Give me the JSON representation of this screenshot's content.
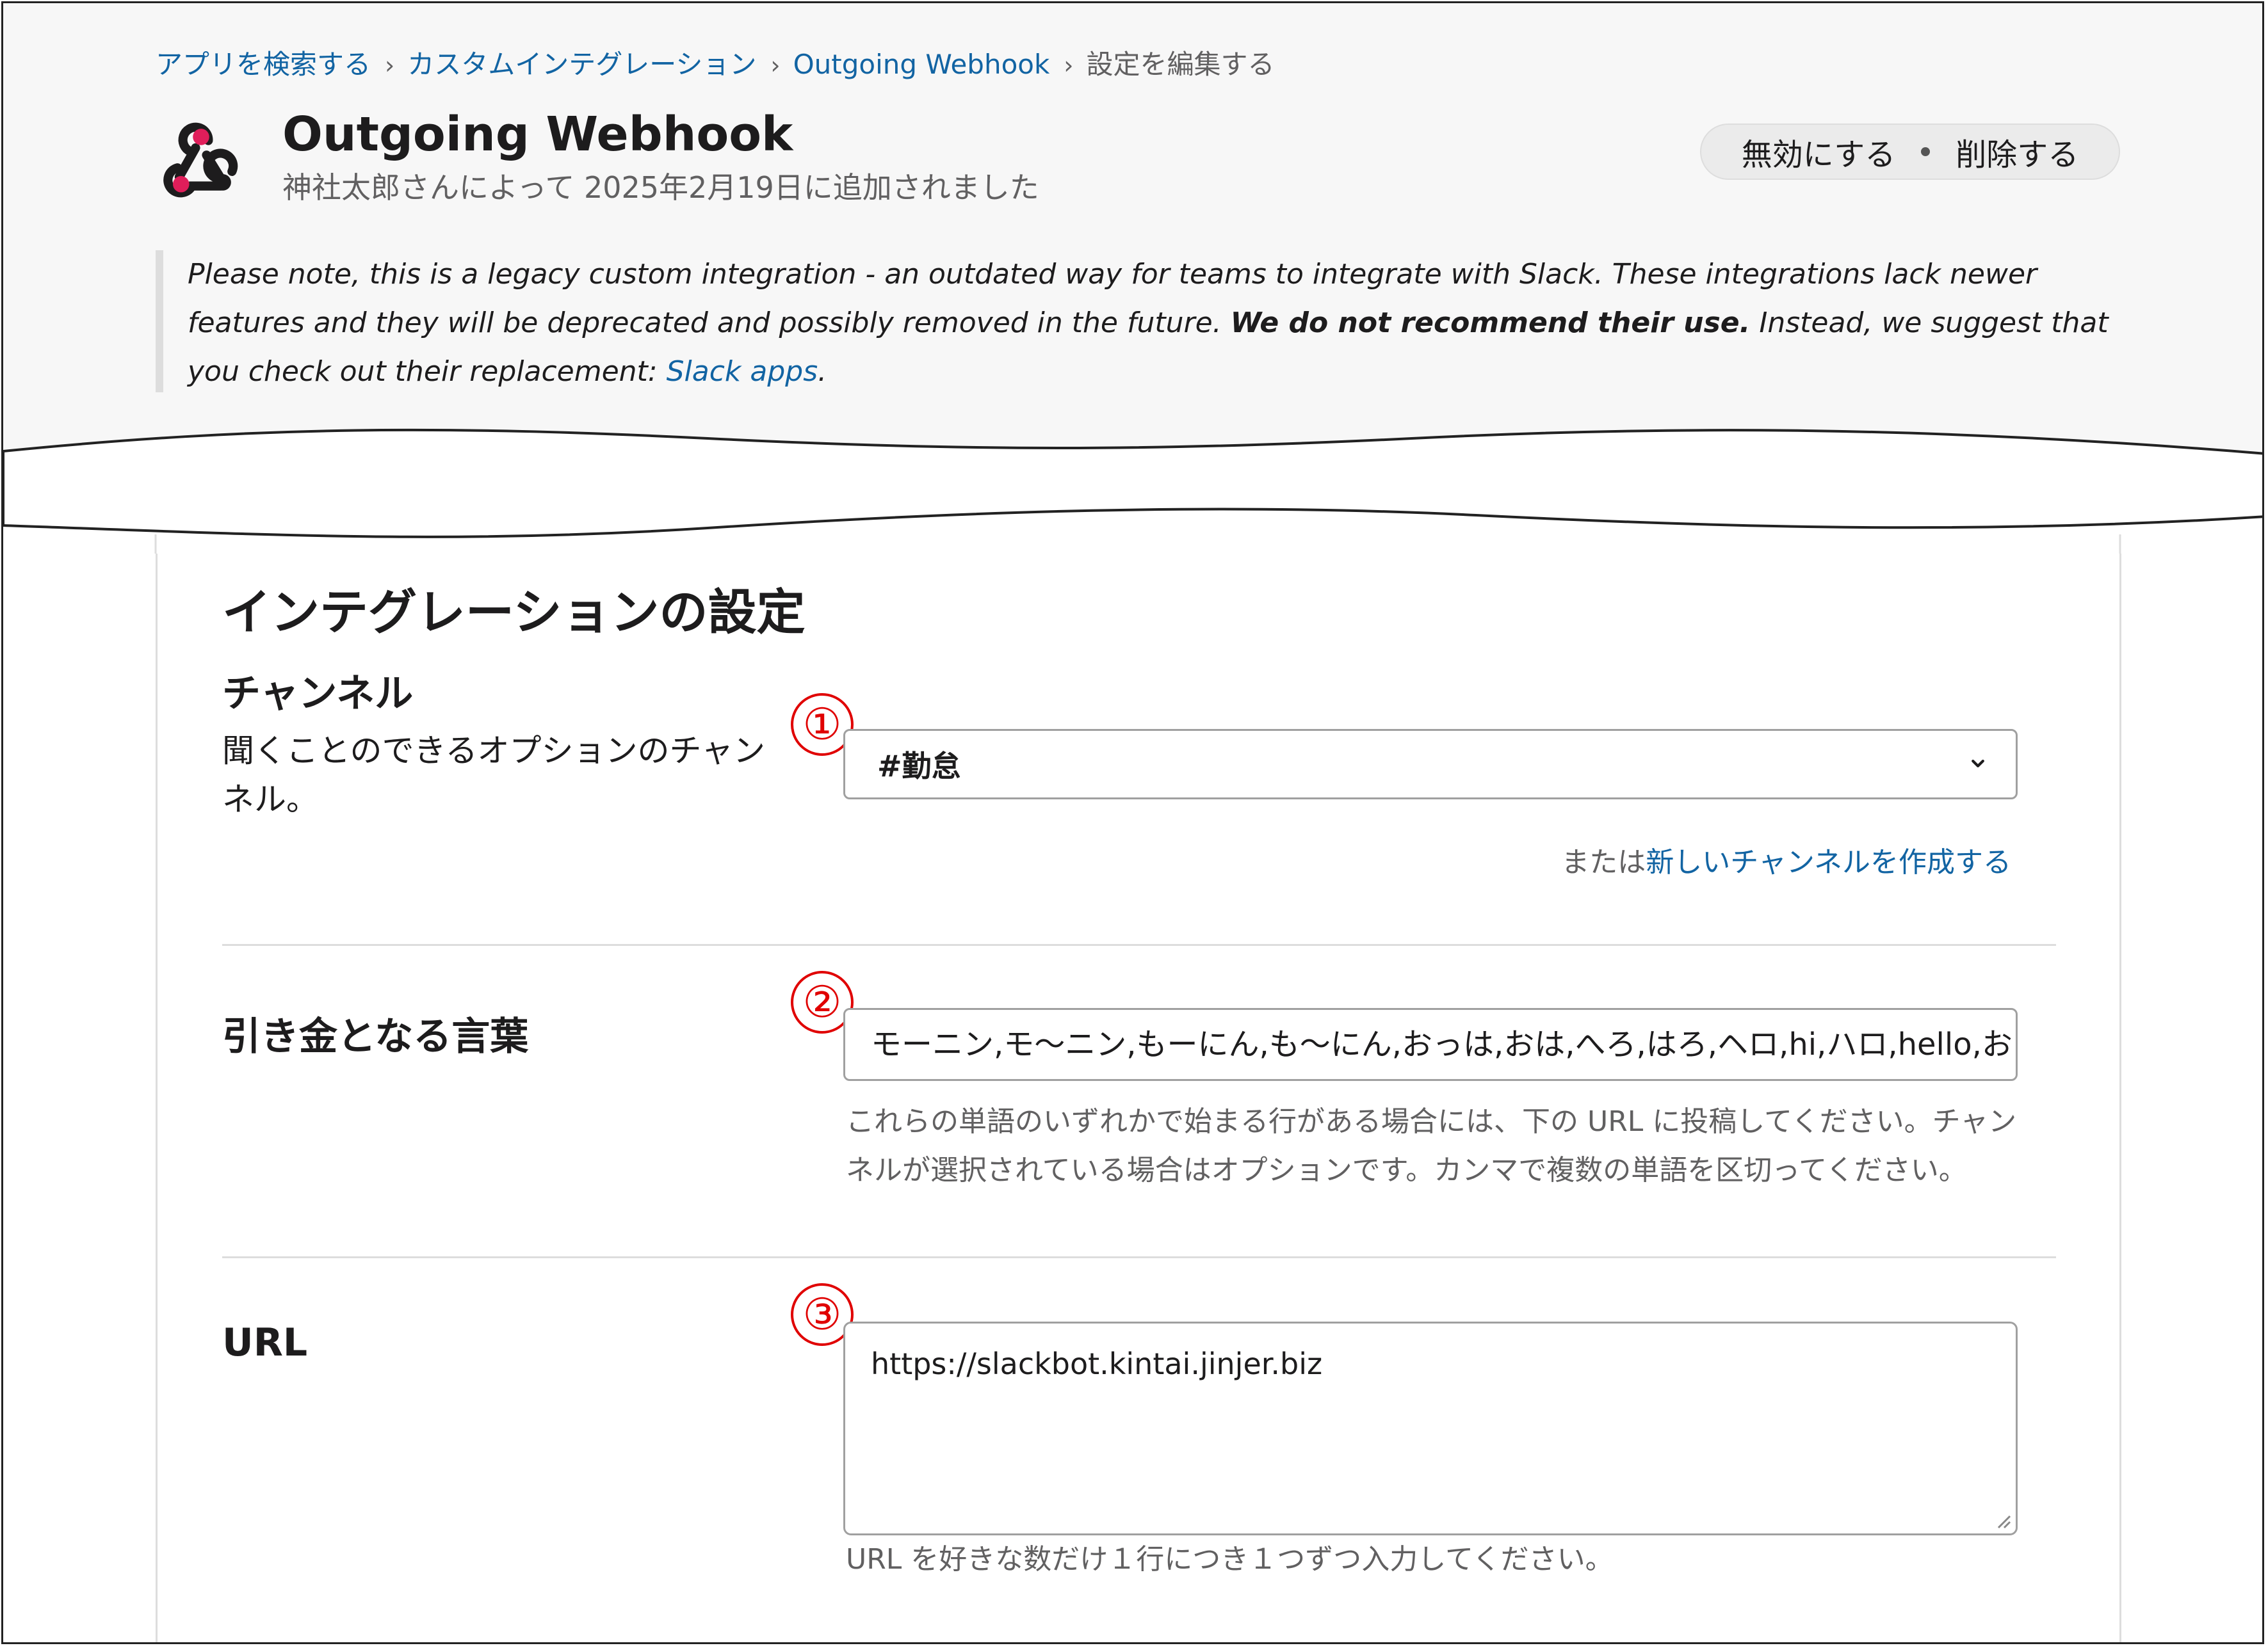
{
  "breadcrumb": {
    "items": [
      "アプリを検索する",
      "カスタムインテグレーション",
      "Outgoing Webhook"
    ],
    "current": "設定を編集する",
    "separator": "›"
  },
  "app": {
    "title": "Outgoing Webhook",
    "subtitle": "神社太郎さんによって 2025年2月19日に追加されました",
    "logo_icon": "webhook-icon",
    "disable_label": "無効にする",
    "delete_label": "削除する"
  },
  "notice": {
    "text_1": "Please note, this is a legacy custom integration - an outdated way for teams to integrate with Slack. These integrations lack newer features and they will be deprecated and possibly removed in the future. ",
    "bold": "We do not recommend their use.",
    "text_2": " Instead, we suggest that you check out their replacement: ",
    "link": "Slack apps",
    "end": "."
  },
  "settings": {
    "title": "インテグレーションの設定",
    "channel": {
      "label": "チャンネル",
      "description": "聞くことのできるオプションのチャンネル。",
      "marker": "①",
      "selected": "#勤怠",
      "create_prefix": "または",
      "create_link": "新しいチャンネルを作成する"
    },
    "trigger": {
      "label": "引き金となる言葉",
      "marker": "②",
      "value": "モーニン,モ〜ニン,もーにん,も〜にん,おっは,おは,へろ,はろ,ヘロ,hi,ハロ,hello,お",
      "hint": "これらの単語のいずれかで始まる行がある場合には、下の URL に投稿してください。チャンネルが選択されている場合はオプションです。カンマで複数の単語を区切ってください。"
    },
    "url": {
      "label": "URL",
      "marker": "③",
      "value": "https://slackbot.kintai.jinjer.biz",
      "hint": "URL を好きな数だけ１行につき１つずつ入力してください。"
    }
  },
  "colors": {
    "link": "#1264a3",
    "marker": "#e00000",
    "logo": "#e01e5a"
  }
}
